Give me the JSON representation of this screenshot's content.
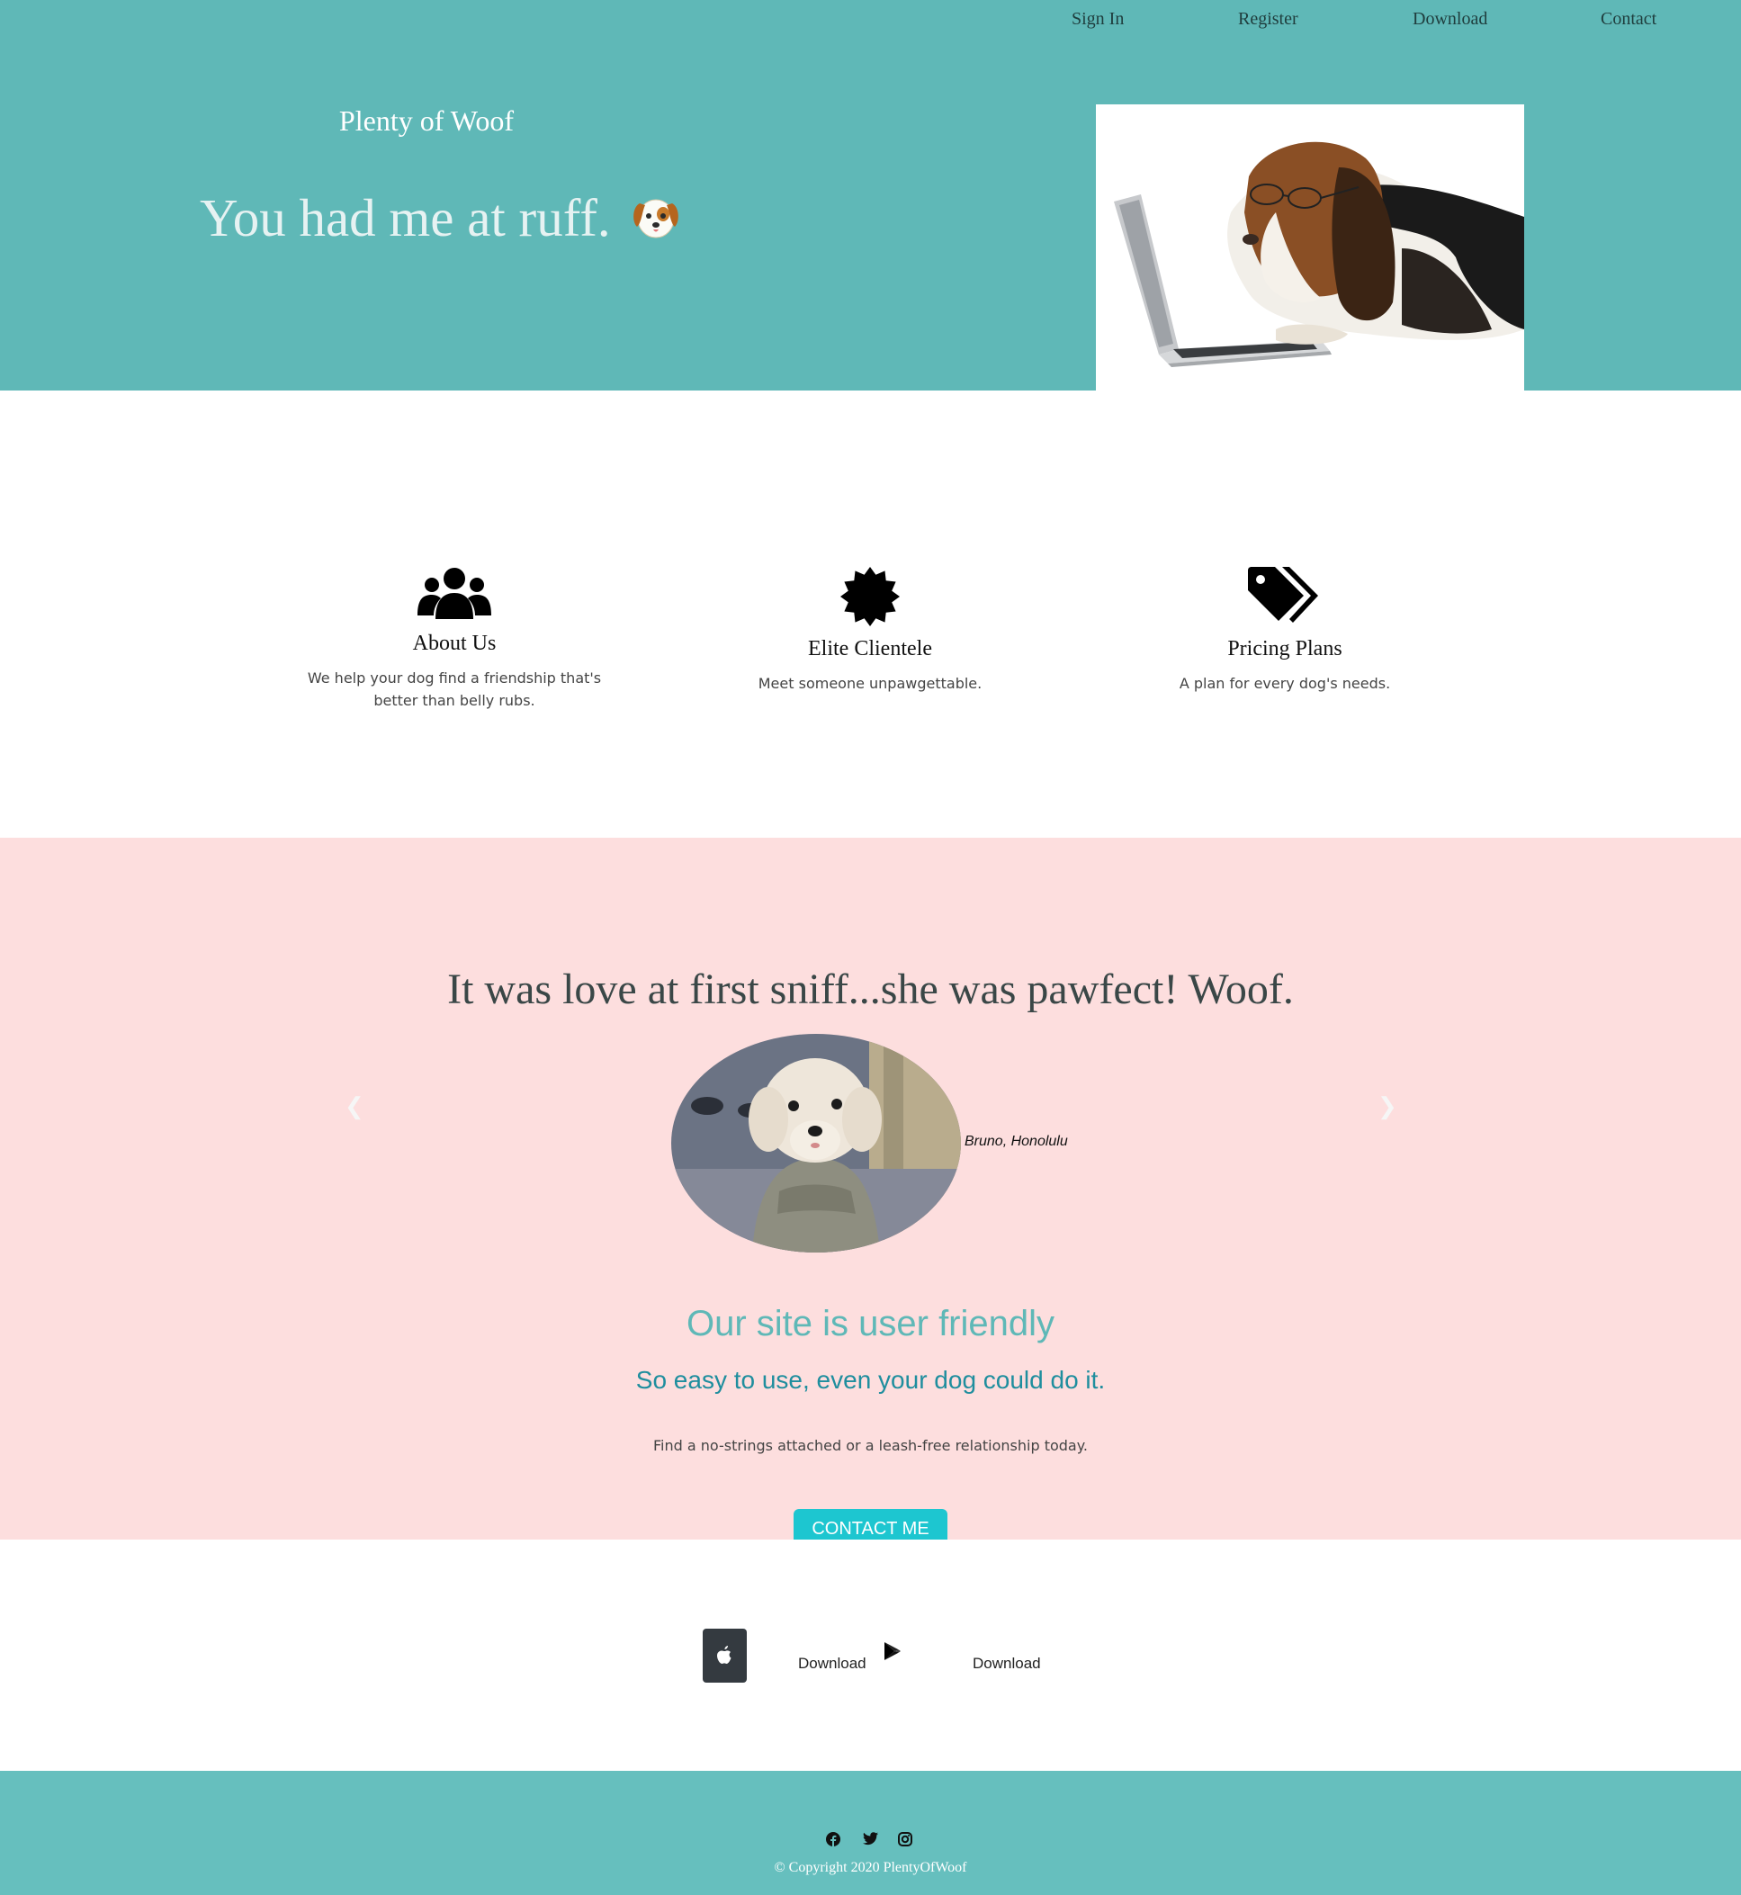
{
  "nav": {
    "sign_in": "Sign In",
    "register": "Register",
    "download": "Download",
    "contact": "Contact"
  },
  "hero": {
    "brand": "Plenty of Woof",
    "tagline": "You had me at ruff.",
    "emoji_icon": "dog-face-icon"
  },
  "features": [
    {
      "icon": "users-icon",
      "title": "About Us",
      "text": "We help your dog find a friendship that's better than belly rubs."
    },
    {
      "icon": "certificate-badge-icon",
      "title": "Elite Clientele",
      "text": "Meet someone unpawgettable."
    },
    {
      "icon": "tags-icon",
      "title": "Pricing Plans",
      "text": "A plan for every dog's needs."
    }
  ],
  "testimonial": {
    "quote": "It was love at first sniff...she was pawfect! Woof.",
    "caption": "Bruno, Honolulu",
    "prev_icon": "chevron-left-icon",
    "next_icon": "chevron-right-icon"
  },
  "cta": {
    "title": "Our site is user friendly",
    "subtitle": "So easy to use, even your dog could do it.",
    "text": "Find a no-strings attached or a leash-free relationship today.",
    "button": "CONTACT ME"
  },
  "downloads": {
    "apple_label": "Download",
    "google_label": "Download",
    "apple_icon": "apple-icon",
    "google_icon": "google-play-icon"
  },
  "footer": {
    "copyright": "© Copyright 2020 PlentyOfWoof",
    "social_icons": [
      "facebook-icon",
      "twitter-icon",
      "instagram-icon"
    ]
  },
  "colors": {
    "hero_bg": "#5fb8b7",
    "testimonial_bg": "#fddede",
    "footer_bg": "#66bfbe",
    "button_bg": "#1dc6d0",
    "cta_title": "#5fb8b7",
    "cta_subtitle": "#1f8e9e"
  }
}
